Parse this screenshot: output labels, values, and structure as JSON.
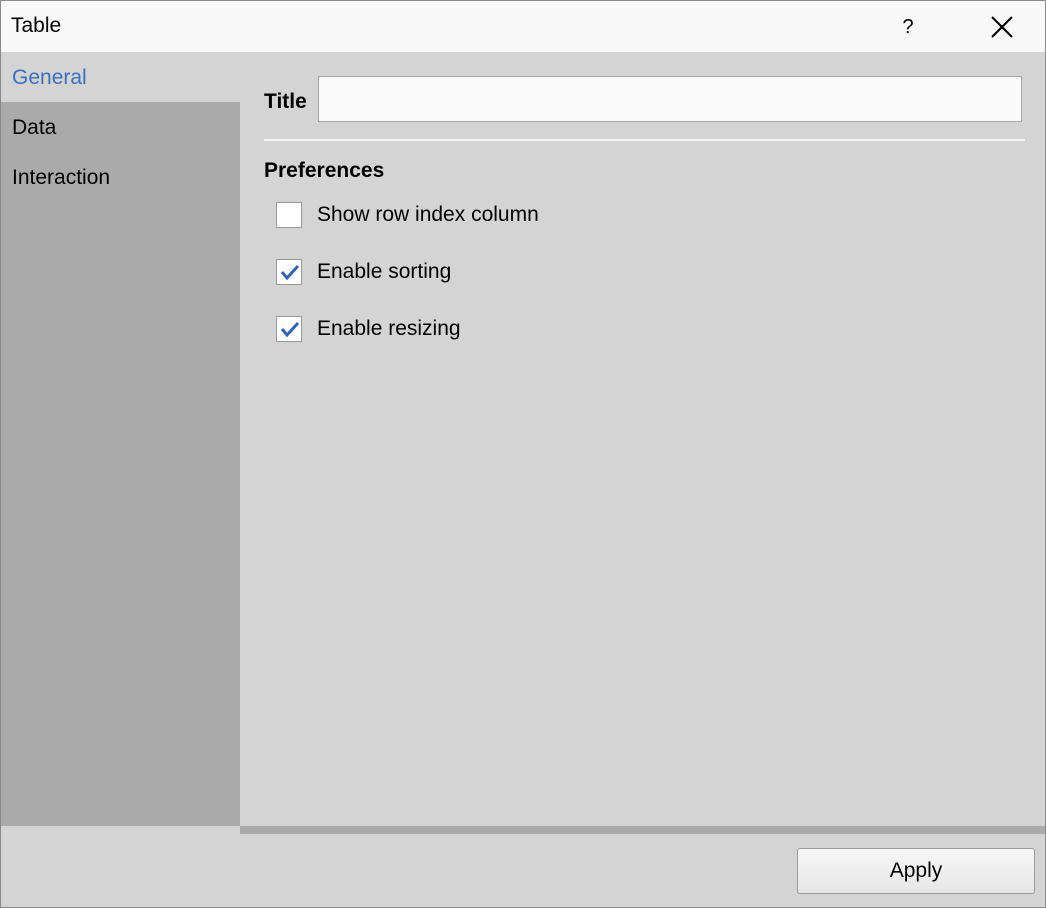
{
  "window": {
    "title": "Table",
    "help_label": "?"
  },
  "sidebar": {
    "items": [
      {
        "label": "General",
        "active": true
      },
      {
        "label": "Data",
        "active": false
      },
      {
        "label": "Interaction",
        "active": false
      }
    ]
  },
  "general": {
    "title_label": "Title",
    "title_value": "",
    "preferences_heading": "Preferences",
    "options": [
      {
        "label": "Show row index column",
        "checked": false
      },
      {
        "label": "Enable sorting",
        "checked": true
      },
      {
        "label": "Enable resizing",
        "checked": true
      }
    ]
  },
  "footer": {
    "apply_label": "Apply"
  },
  "colors": {
    "accent": "#3a6fc0",
    "sidebar_bg": "#aaaaaa",
    "panel_bg": "#d4d4d4",
    "check_color": "#2c63b8"
  }
}
